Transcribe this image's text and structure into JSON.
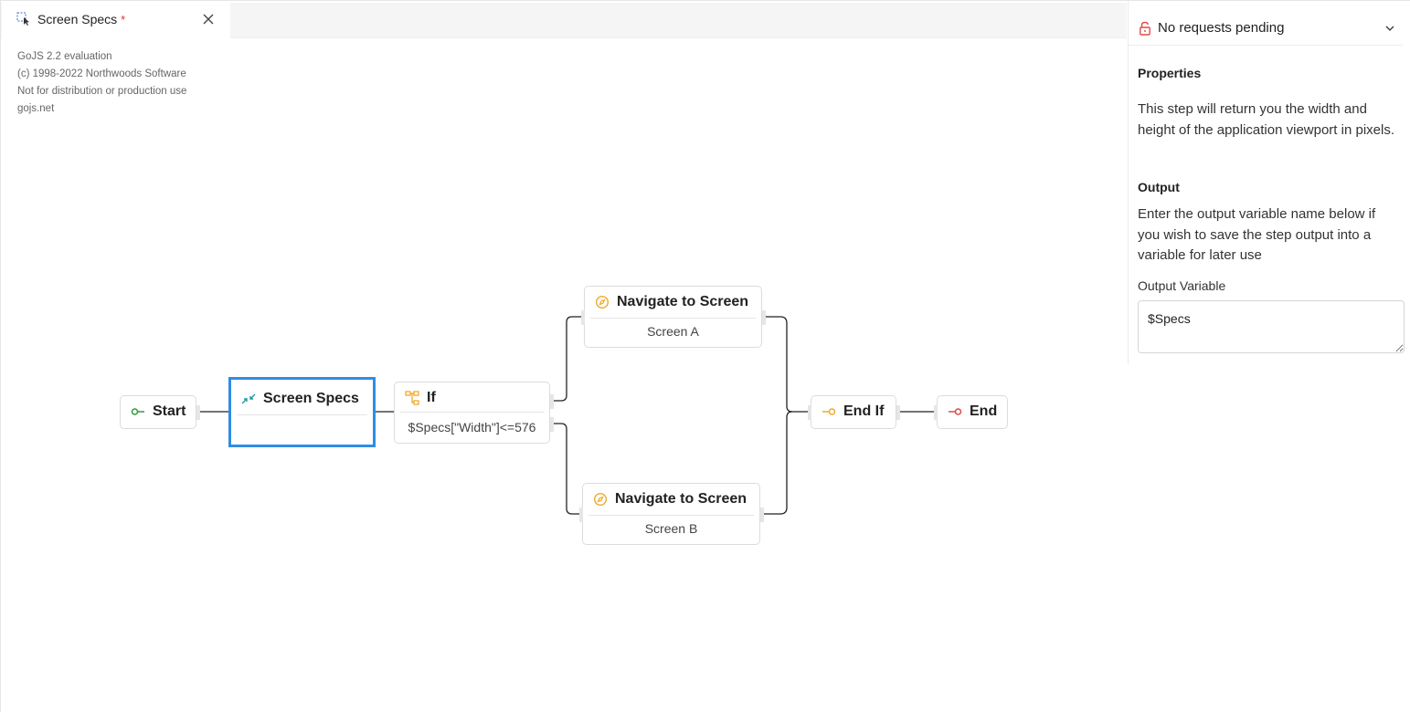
{
  "tab": {
    "title": "Screen Specs",
    "dirty_marker": "*",
    "icon": "select-pointer-icon",
    "close_icon": "close-icon"
  },
  "watermark": {
    "lines": [
      "GoJS 2.2 evaluation",
      "(c) 1998-2022 Northwoods Software",
      "Not for distribution or production use",
      "gojs.net"
    ]
  },
  "flow": {
    "start": {
      "label": "Start",
      "icon": "start-key-icon"
    },
    "screen_specs": {
      "label": "Screen Specs",
      "icon": "compress-arrows-icon",
      "subtitle": ""
    },
    "if_node": {
      "label": "If",
      "icon": "branch-tree-icon",
      "subtitle": "$Specs[\"Width\"]<=576"
    },
    "navigate_a": {
      "label": "Navigate to Screen",
      "icon": "navigate-compass-icon",
      "subtitle": "Screen A"
    },
    "navigate_b": {
      "label": "Navigate to Screen",
      "icon": "navigate-compass-icon",
      "subtitle": "Screen B"
    },
    "end_if": {
      "label": "End If",
      "icon": "end-if-key-icon"
    },
    "end": {
      "label": "End",
      "icon": "end-key-icon"
    }
  },
  "panel": {
    "requests_label": "No requests pending",
    "properties_heading": "Properties",
    "properties_text": "This step will return you the width and height of the application viewport in pixels.",
    "output_heading": "Output",
    "output_text": "Enter the output variable name below if you wish to save the step output into a variable for later use",
    "output_variable_label": "Output Variable",
    "output_variable_value": "$Specs"
  },
  "colors": {
    "selection": "#2f8de4",
    "start_green": "#2e9b3b",
    "end_red": "#e04a4a",
    "accent_orange": "#f0a92a",
    "compress_teal": "#1f9aa6"
  }
}
